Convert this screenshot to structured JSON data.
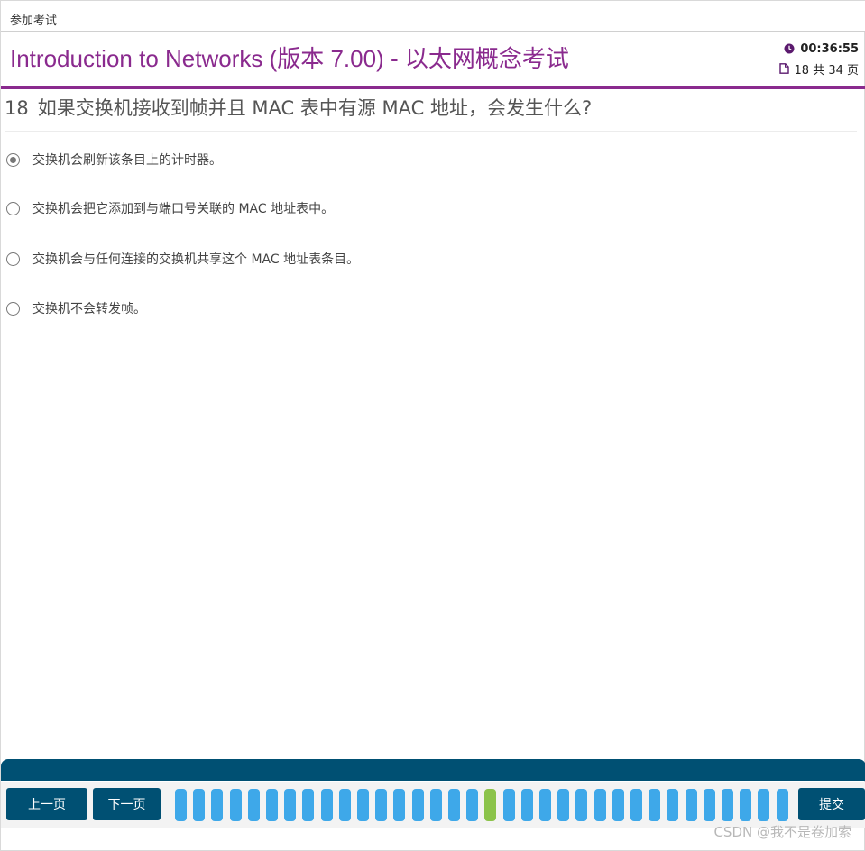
{
  "topbar": {
    "breadcrumb": "参加考试"
  },
  "header": {
    "title": "Introduction to Networks (版本 7.00) - 以太网概念考试",
    "timer": "00:36:55",
    "page_indicator": "18 共 34 页"
  },
  "question": {
    "number": "18",
    "text": "如果交换机接收到帧并且 MAC 表中有源 MAC 地址，会发生什么?"
  },
  "options": [
    {
      "label": "交换机会刷新该条目上的计时器。",
      "selected": true
    },
    {
      "label": "交换机会把它添加到与端口号关联的 MAC 地址表中。",
      "selected": false
    },
    {
      "label": "交换机会与任何连接的交换机共享这个 MAC 地址表条目。",
      "selected": false
    },
    {
      "label": "交换机不会转发帧。",
      "selected": false
    }
  ],
  "footer": {
    "prev_label": "上一页",
    "next_label": "下一页",
    "submit_label": "提交",
    "question_count": 34,
    "current_question": 18
  },
  "colors": {
    "accent": "#8a2a8e",
    "nav_bar": "#005073",
    "question_cell": "#3ea8e9",
    "current_cell": "#8bc34a"
  },
  "watermark": "CSDN @我不是卷加索"
}
